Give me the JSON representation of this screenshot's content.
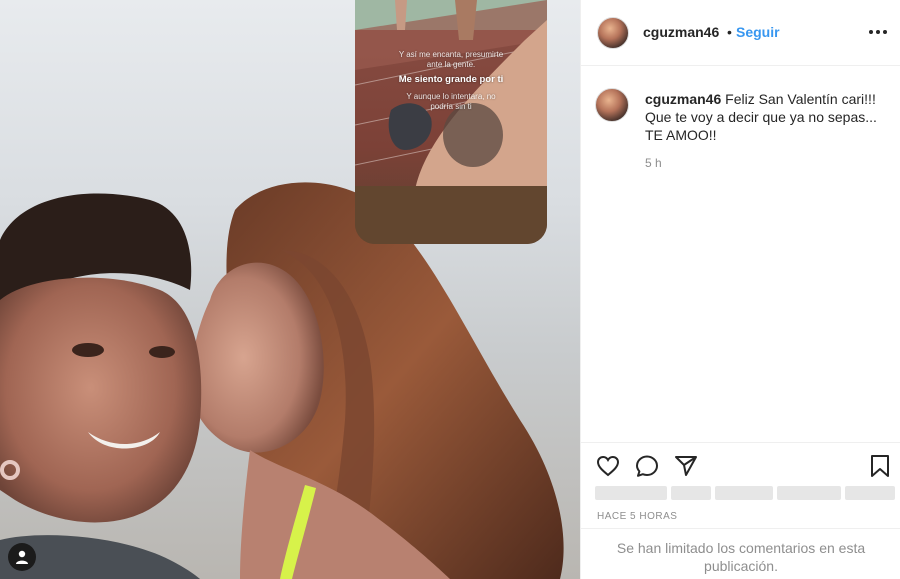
{
  "photo": {
    "story_caption_lines": [
      "Y así me encanta, presumirte",
      "ante la gente.",
      "Me siento grande por ti",
      "Y aunque lo intentara, no",
      "podría sin ti"
    ],
    "user_tag_icon": "user-icon"
  },
  "post": {
    "author": "cguzman46",
    "separator": "•",
    "follow_label": "Seguir",
    "more_icon": "more-options-icon",
    "caption_username": "cguzman46",
    "caption_text": "Feliz San Valentín cari!!! Que te voy a decir que ya no sepas... TE AMOO!!",
    "time_ago": "5 h",
    "actions": [
      "heart-icon",
      "comment-icon",
      "share-icon",
      "bookmark-icon"
    ],
    "posted_label": "HACE 5 HORAS",
    "comments_limited": "Se han limitado los comentarios en esta publicación."
  }
}
